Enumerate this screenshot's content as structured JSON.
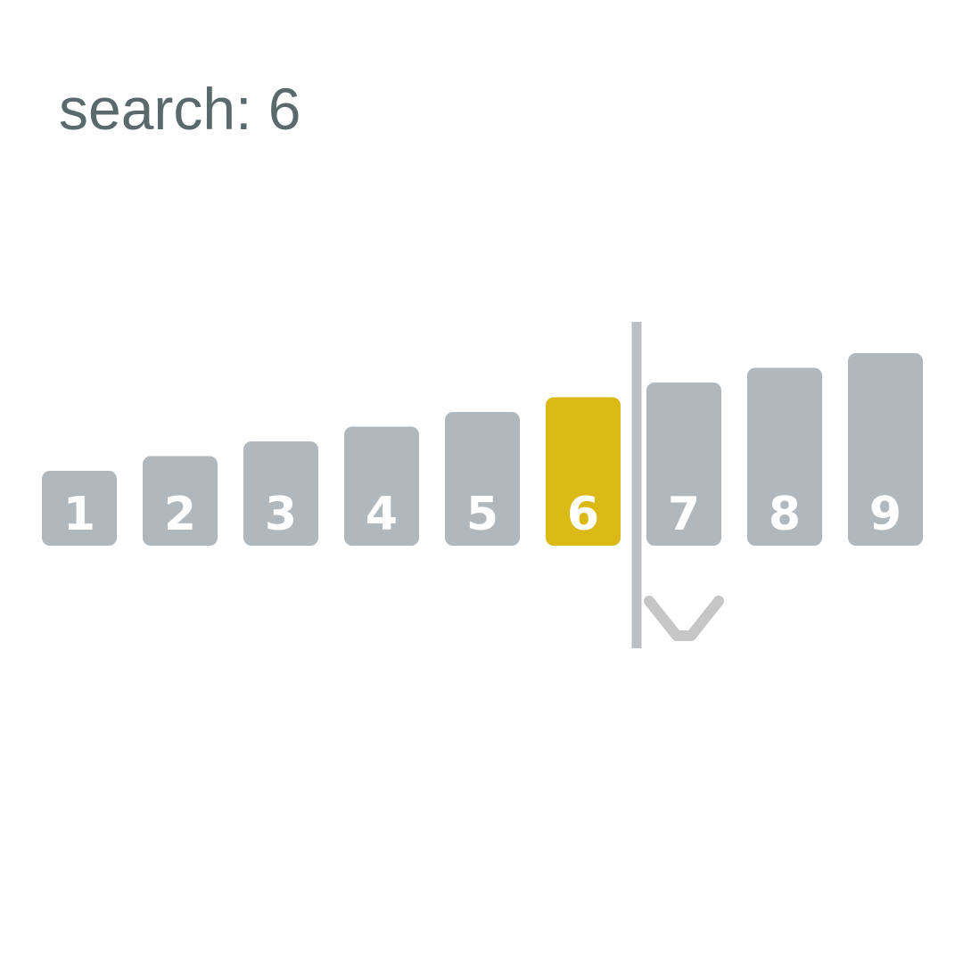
{
  "header": {
    "prefix": "search:",
    "target": "6"
  },
  "array": {
    "items": [
      {
        "label": "1",
        "value": 1,
        "state": "default"
      },
      {
        "label": "2",
        "value": 2,
        "state": "default"
      },
      {
        "label": "3",
        "value": 3,
        "state": "default"
      },
      {
        "label": "4",
        "value": 4,
        "state": "default"
      },
      {
        "label": "5",
        "value": 5,
        "state": "default"
      },
      {
        "label": "6",
        "value": 6,
        "state": "found"
      },
      {
        "label": "7",
        "value": 7,
        "state": "default"
      },
      {
        "label": "8",
        "value": 8,
        "state": "default"
      },
      {
        "label": "9",
        "value": 9,
        "state": "default"
      }
    ],
    "divider_after_index": 5,
    "pointer_index": 6
  },
  "colors": {
    "default_bar": "#b1b8bd",
    "found_bar": "#dbba17",
    "divider": "#bcc0c3",
    "pointer": "#c6c6c6",
    "text": "#59696c"
  }
}
